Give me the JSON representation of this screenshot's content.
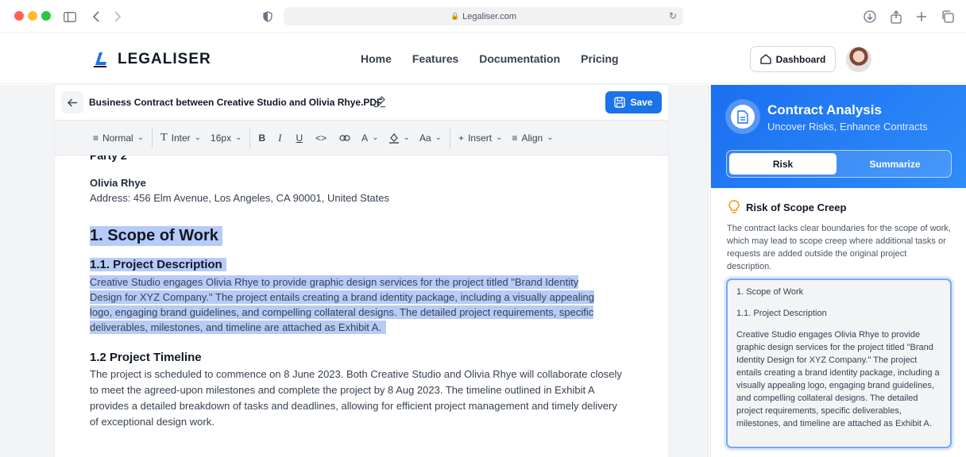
{
  "browser": {
    "url": "Legaliser.com",
    "colors": {
      "close": "#ff5f57",
      "minimize": "#febc2e",
      "maximize": "#28c840"
    }
  },
  "header": {
    "brand": "LEGALISER",
    "nav": [
      "Home",
      "Features",
      "Documentation",
      "Pricing"
    ],
    "dashboard_label": "Dashboard"
  },
  "editor": {
    "title": "Business Contract between Creative Studio and Olivia Rhye.PDF",
    "save_label": "Save",
    "toolbar": {
      "style": "Normal",
      "font": "Inter",
      "size": "16px",
      "bold": "B",
      "italic": "I",
      "underline": "U",
      "color_glyph": "A",
      "case_glyph": "Aa",
      "insert": "Insert",
      "align": "Align"
    },
    "doc": {
      "party_heading": "Party 2",
      "party_name": "Olivia Rhye",
      "party_address": "Address: 456 Elm Avenue, Los Angeles, CA 90001, United States",
      "section1_title": "1. Scope of Work",
      "section1_1_title": "1.1. Project Description",
      "section1_1_lines": [
        "Creative Studio engages Olivia Rhye to provide graphic design services for the project titled \"Brand Identity",
        "Design for XYZ Company.\" The project entails creating a brand identity package, including a visually appealing",
        "logo, engaging brand guidelines, and compelling collateral designs. The detailed project requirements, specific",
        "deliverables, milestones, and timeline are attached as Exhibit A."
      ],
      "section1_2_title": "1.2 Project Timeline",
      "section1_2_text": "The project is scheduled to commence on 8 June 2023. Both Creative Studio and Olivia Rhye will collaborate closely to meet the agreed-upon milestones and complete the project by 8 Aug 2023. The timeline outlined in Exhibit A provides a detailed breakdown of tasks and deadlines, allowing for efficient project management and timely delivery of exceptional design work."
    }
  },
  "panel": {
    "title": "Contract Analysis",
    "subtitle": "Uncover Risks, Enhance Contracts",
    "tabs": {
      "risk": "Risk",
      "summarize": "Summarize"
    },
    "risk_title": "Risk of Scope Creep",
    "risk_description": "The contract lacks clear boundaries for the scope of work, which may lead to scope creep where additional tasks or requests are added outside the original project description.",
    "quote": {
      "line1": "1. Scope of Work",
      "line2": "1.1. Project Description",
      "line3": "Creative Studio engages Olivia Rhye to provide graphic design services for the project titled \"Brand Identity Design for XYZ Company.\" The project entails creating a brand identity package, including a visually appealing logo, engaging brand guidelines, and compelling collateral designs. The detailed project requirements, specific deliverables, milestones, and timeline are attached as Exhibit A."
    },
    "accent": "#1a73e8"
  }
}
